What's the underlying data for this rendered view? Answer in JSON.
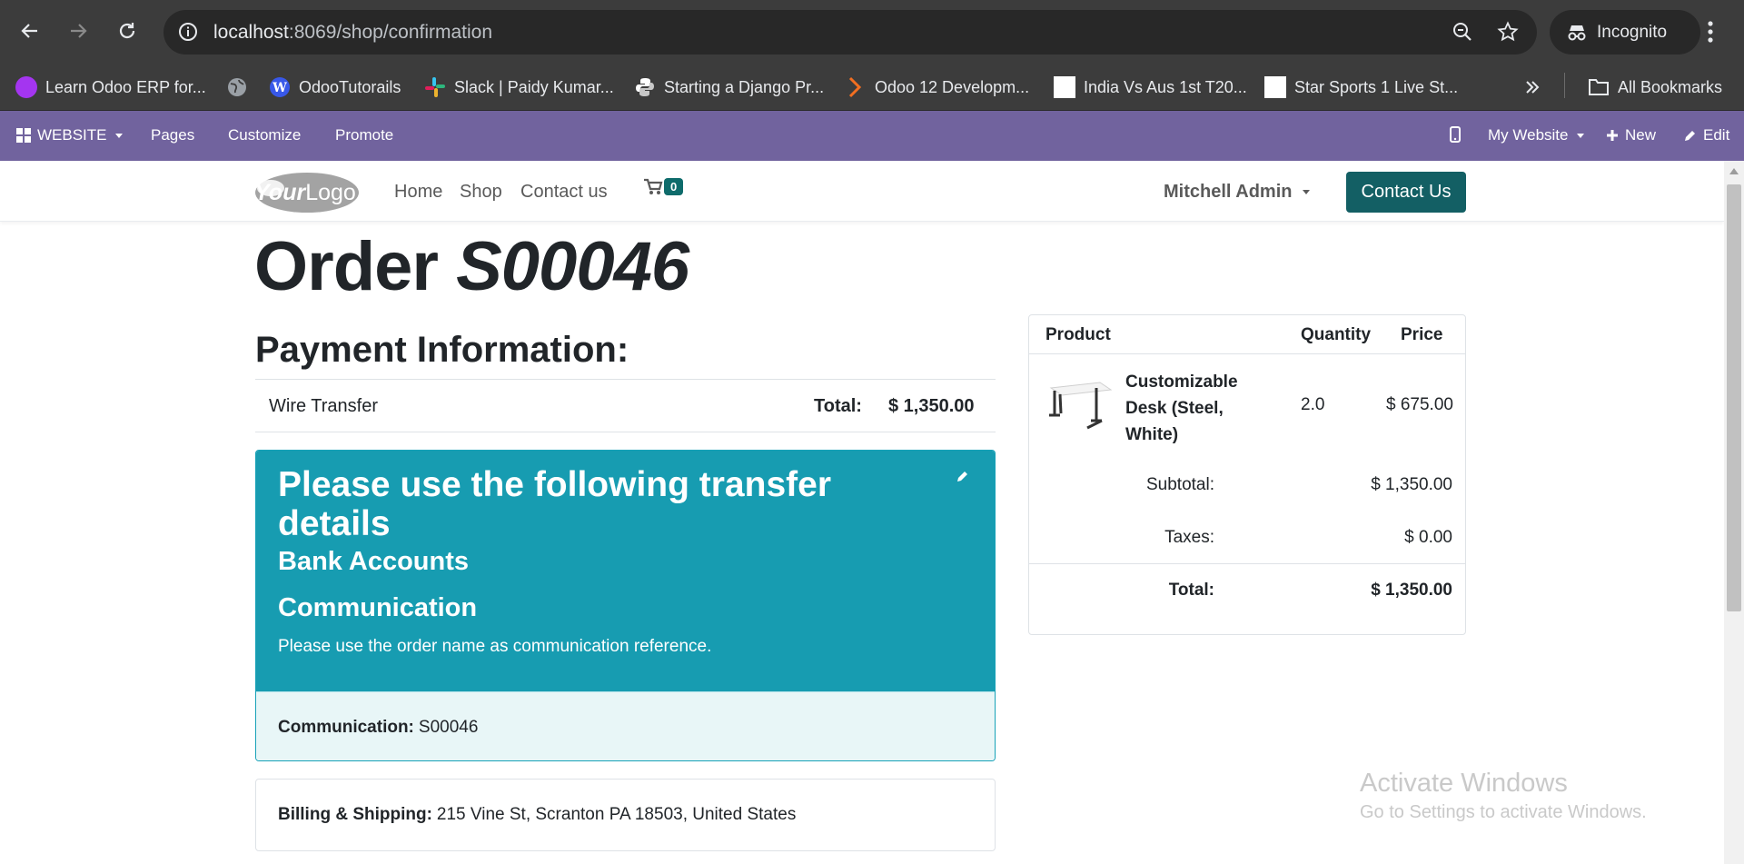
{
  "browser": {
    "url_host": "localhost",
    "url_rest": ":8069/shop/confirmation",
    "incognito_label": "Incognito",
    "bookmarks": [
      {
        "label": "Learn Odoo ERP for...",
        "icon": "udemy-icon",
        "color": "#a435f0"
      },
      {
        "label": "",
        "icon": "globe-icon",
        "color": "#9aa0a6"
      },
      {
        "label": "OdooTutorails",
        "icon": "wordpress-icon",
        "color": "#3858e9"
      },
      {
        "label": "Slack | Paidy Kumar...",
        "icon": "slack-icon",
        "color": "#e01e5a"
      },
      {
        "label": "Starting a Django Pr...",
        "icon": "python-icon",
        "color": "#ffffff"
      },
      {
        "label": "Odoo 12 Developm...",
        "icon": "packt-icon",
        "color": "#f26f21"
      },
      {
        "label": "India Vs Aus 1st T20...",
        "icon": "blank-page-icon",
        "color": "#ffffff"
      },
      {
        "label": "Star Sports 1 Live St...",
        "icon": "blank-page-icon",
        "color": "#ffffff"
      }
    ],
    "all_bookmarks_label": "All Bookmarks"
  },
  "admin_bar": {
    "website_label": "WEBSITE",
    "pages_label": "Pages",
    "customize_label": "Customize",
    "promote_label": "Promote",
    "my_website_label": "My Website",
    "new_label": "New",
    "edit_label": "Edit"
  },
  "site_header": {
    "logo_text": "YourLogo",
    "menu": [
      "Home",
      "Shop",
      "Contact us"
    ],
    "cart_count": "0",
    "user_name": "Mitchell Admin",
    "contact_button": "Contact Us"
  },
  "order": {
    "title_prefix": "Order",
    "title_number": "S00046",
    "payment_heading": "Payment Information:",
    "payment_method": "Wire Transfer",
    "total_label": "Total:",
    "total_value": "$ 1,350.00",
    "transfer_heading": "Please use the following transfer details",
    "bank_accounts_heading": "Bank Accounts",
    "communication_heading": "Communication",
    "communication_note": "Please use the order name as communication reference.",
    "communication_label": "Communication:",
    "communication_value": "S00046",
    "billing_label": "Billing & Shipping:",
    "billing_value": "215 Vine St, Scranton PA 18503, United States"
  },
  "summary": {
    "headers": {
      "product": "Product",
      "quantity": "Quantity",
      "price": "Price"
    },
    "items": [
      {
        "name": "Customizable Desk (Steel, White)",
        "quantity": "2.0",
        "price": "$ 675.00"
      }
    ],
    "subtotal_label": "Subtotal:",
    "subtotal_value": "$ 1,350.00",
    "taxes_label": "Taxes:",
    "taxes_value": "$ 0.00",
    "total_label": "Total:",
    "total_value": "$ 1,350.00"
  },
  "watermark": {
    "line1": "Activate Windows",
    "line2": "Go to Settings to activate Windows."
  },
  "colors": {
    "admin_bar": "#71639e",
    "primary": "#135f64",
    "info": "#179cb1"
  }
}
